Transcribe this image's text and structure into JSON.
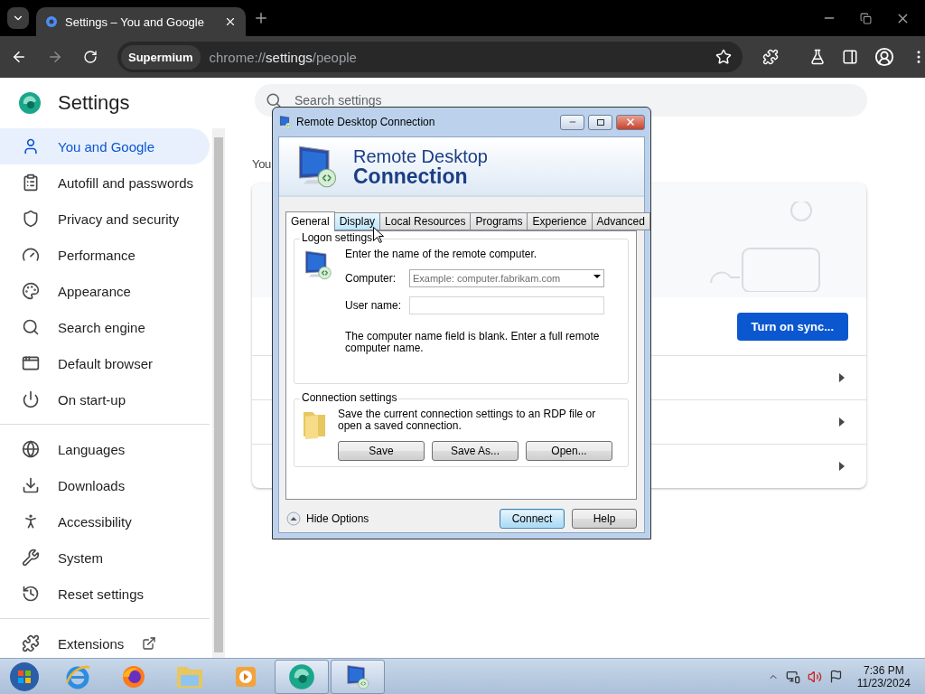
{
  "browser": {
    "tab": {
      "title": "Settings – You and Google",
      "selected": true
    },
    "address": {
      "badge": "Supermium",
      "scheme": "chrome://",
      "host": "settings",
      "path": "/people"
    }
  },
  "settings": {
    "title": "Settings",
    "search": {
      "placeholder": "Search settings"
    },
    "nav_sections": [
      {
        "items": [
          {
            "label": "You and Google",
            "selected": true
          },
          {
            "label": "Autofill and passwords",
            "selected": false
          },
          {
            "label": "Privacy and security",
            "selected": false
          },
          {
            "label": "Performance",
            "selected": false
          },
          {
            "label": "Appearance",
            "selected": false
          },
          {
            "label": "Search engine",
            "selected": false
          },
          {
            "label": "Default browser",
            "selected": false
          },
          {
            "label": "On start-up",
            "selected": false
          }
        ]
      },
      {
        "items": [
          {
            "label": "Languages",
            "selected": false
          },
          {
            "label": "Downloads",
            "selected": false
          },
          {
            "label": "Accessibility",
            "selected": false
          },
          {
            "label": "System",
            "selected": false
          },
          {
            "label": "Reset settings",
            "selected": false
          }
        ]
      },
      {
        "items": [
          {
            "label": "Extensions",
            "selected": false,
            "external": true
          }
        ]
      }
    ],
    "heading": "You",
    "sync_button": "Turn on sync...",
    "card_rows": [
      {
        "kind": "link"
      },
      {
        "kind": "link"
      },
      {
        "kind": "link"
      }
    ]
  },
  "dialog": {
    "title": "Remote Desktop Connection",
    "banner": {
      "line_1": "Remote Desktop",
      "line_2": "Connection"
    },
    "tabs": [
      {
        "label": "General",
        "selected": true,
        "hovered": false
      },
      {
        "label": "Display",
        "selected": false,
        "hovered": true
      },
      {
        "label": "Local Resources",
        "selected": false,
        "hovered": false
      },
      {
        "label": "Programs",
        "selected": false,
        "hovered": false
      },
      {
        "label": "Experience",
        "selected": false,
        "hovered": false
      },
      {
        "label": "Advanced",
        "selected": false,
        "hovered": false
      }
    ],
    "logon": {
      "legend": "Logon settings",
      "instruction": "Enter the name of the remote computer.",
      "computer_label": "Computer:",
      "computer_placeholder": "Example: computer.fabrikam.com",
      "user_label": "User name:",
      "note": "The computer name field is blank. Enter a full remote computer name."
    },
    "connection": {
      "legend": "Connection settings",
      "text": "Save the current connection settings to an RDP file or open a saved connection.",
      "buttons": [
        "Save",
        "Save As...",
        "Open..."
      ]
    },
    "options_toggle": "Hide Options",
    "buttons": [
      {
        "label": "Connect",
        "default": true
      },
      {
        "label": "Help",
        "default": false
      }
    ]
  },
  "taskbar": {
    "apps": [
      {
        "kind": "ie",
        "active": false
      },
      {
        "kind": "firefox",
        "active": false
      },
      {
        "kind": "explorer",
        "active": false
      },
      {
        "kind": "media",
        "active": false
      },
      {
        "kind": "supermium",
        "active": true
      },
      {
        "kind": "rdc",
        "active": true
      }
    ],
    "time": "7:36 PM",
    "date": "11/23/2024"
  }
}
